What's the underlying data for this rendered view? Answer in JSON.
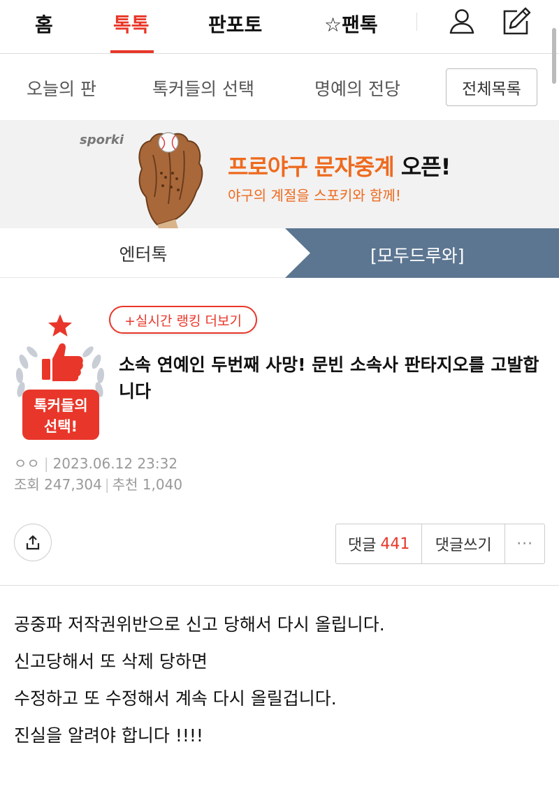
{
  "nav": {
    "tabs": [
      {
        "label": "홈",
        "active": false
      },
      {
        "label": "톡톡",
        "active": true
      },
      {
        "label": "판포토",
        "active": false
      },
      {
        "label": "☆팬톡",
        "active": false
      }
    ],
    "icons": [
      "user-icon",
      "write-icon"
    ],
    "accent_color": "#e8372a"
  },
  "subnav": {
    "items": [
      "오늘의 판",
      "톡커들의 선택",
      "명예의 전당"
    ],
    "all_list_label": "전체목록"
  },
  "banner": {
    "brand": "sporki",
    "title_highlight": "프로야구 문자중계",
    "title_rest": " 오픈!",
    "subtitle": "야구의 계절을 스포키와 함께!",
    "highlight_color": "#ee6a1e"
  },
  "section_tabs": {
    "left": "엔터톡",
    "right": "[모두드루와]",
    "right_bg": "#5c7691"
  },
  "post": {
    "badge_line1": "톡커들의",
    "badge_line2": "선택!",
    "ranking_button": "+실시간 랭킹 더보기",
    "title": "소속 연예인 두번째 사망! 문빈 소속사 판타지오를 고발합니다",
    "author": "ㅇㅇ",
    "date": "2023.06.12 23:32",
    "views_label": "조회",
    "views": "247,304",
    "recommend_label": "추천",
    "recommends": "1,040",
    "comments_label": "댓글",
    "comments_count": "441",
    "write_comment_label": "댓글쓰기",
    "more_label": "···",
    "body_lines": [
      "공중파 저작권위반으로 신고 당해서 다시 올립니다.",
      "신고당해서 또 삭제 당하면",
      "수정하고 또 수정해서 계속 다시 올릴겁니다.",
      "진실을 알려야 합니다 !!!!"
    ]
  }
}
